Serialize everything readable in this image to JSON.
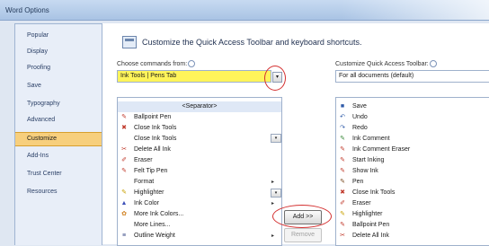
{
  "window": {
    "title": "Word Options"
  },
  "sidebar": {
    "items": [
      {
        "label": "Popular",
        "selected": false
      },
      {
        "label": "Display",
        "selected": false
      },
      {
        "label": "Proofing",
        "selected": false
      },
      {
        "label": "Save",
        "selected": false
      },
      {
        "label": "Typography",
        "selected": false
      },
      {
        "label": "Advanced",
        "selected": false
      },
      {
        "label": "Customize",
        "selected": true
      },
      {
        "label": "Add-Ins",
        "selected": false
      },
      {
        "label": "Trust Center",
        "selected": false
      },
      {
        "label": "Resources",
        "selected": false
      }
    ]
  },
  "main": {
    "heading": "Customize the Quick Access Toolbar and keyboard shortcuts.",
    "choose_label": "Choose commands from:",
    "choose_value": "Ink Tools | Pens Tab",
    "customize_label": "Customize Quick Access Toolbar:",
    "customize_value": "For all documents (default)",
    "left_list": [
      {
        "icon": "",
        "label": "<Separator>",
        "arrow": false,
        "selected": true,
        "color": ""
      },
      {
        "icon": "pen",
        "label": "Ballpoint Pen",
        "arrow": false,
        "color": "#c0392b"
      },
      {
        "icon": "close",
        "label": "Close Ink Tools",
        "arrow": false,
        "color": "#c0392b"
      },
      {
        "icon": "",
        "label": "Close Ink Tools",
        "arrow": false,
        "color": ""
      },
      {
        "icon": "delete",
        "label": "Delete All Ink",
        "arrow": false,
        "color": "#c0392b"
      },
      {
        "icon": "eraser",
        "label": "Eraser",
        "arrow": false,
        "color": "#c0392b"
      },
      {
        "icon": "felt",
        "label": "Felt Tip Pen",
        "arrow": false,
        "color": "#c0392b"
      },
      {
        "icon": "",
        "label": "Format",
        "arrow": true,
        "color": ""
      },
      {
        "icon": "highlighter",
        "label": "Highlighter",
        "arrow": false,
        "color": "#c8a000"
      },
      {
        "icon": "inkcolor",
        "label": "Ink Color",
        "arrow": true,
        "color": "#3b4fb8"
      },
      {
        "icon": "morecolors",
        "label": "More Ink Colors...",
        "arrow": false,
        "color": "#d08020"
      },
      {
        "icon": "",
        "label": "More Lines...",
        "arrow": false,
        "color": ""
      },
      {
        "icon": "weight",
        "label": "Outline Weight",
        "arrow": true,
        "color": "#304080"
      }
    ],
    "right_list": [
      {
        "icon": "save",
        "label": "Save",
        "color": "#2e5aa8"
      },
      {
        "icon": "undo",
        "label": "Undo",
        "color": "#2e5aa8"
      },
      {
        "icon": "redo",
        "label": "Redo",
        "color": "#2e5aa8"
      },
      {
        "icon": "comment",
        "label": "Ink Comment",
        "color": "#3a8a3a"
      },
      {
        "icon": "pen",
        "label": "Ink Comment Eraser",
        "color": "#c0392b"
      },
      {
        "icon": "pen",
        "label": "Start Inking",
        "color": "#c0392b"
      },
      {
        "icon": "pen",
        "label": "Show Ink",
        "color": "#c0392b"
      },
      {
        "icon": "pen",
        "label": "Pen",
        "color": "#7a4a20"
      },
      {
        "icon": "close",
        "label": "Close Ink Tools",
        "color": "#c0392b"
      },
      {
        "icon": "eraser",
        "label": "Eraser",
        "color": "#c0392b"
      },
      {
        "icon": "highlighter",
        "label": "Highlighter",
        "color": "#c8a000"
      },
      {
        "icon": "pen",
        "label": "Ballpoint Pen",
        "color": "#c0392b"
      },
      {
        "icon": "delete",
        "label": "Delete All Ink",
        "color": "#c0392b"
      }
    ],
    "add_button": "Add >>",
    "remove_button": "Remove",
    "highlight_color": "#d43030"
  }
}
